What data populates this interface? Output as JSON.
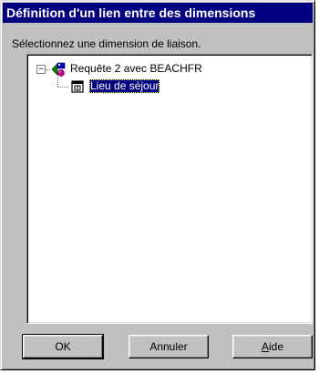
{
  "window": {
    "title": "Définition d'un lien entre des dimensions"
  },
  "prompt": "Sélectionnez une dimension de liaison.",
  "tree": {
    "root": {
      "label": "Requête 2 avec BEACHFR",
      "expander": "−",
      "icon": "query-icon",
      "expanded": true
    },
    "children": [
      {
        "label": "Lieu de séjour",
        "icon": "dimension-icon",
        "selected": true
      }
    ]
  },
  "buttons": {
    "ok": "OK",
    "cancel": "Annuler",
    "help_prefix": "",
    "help_accel": "A",
    "help_rest": "ide"
  },
  "colors": {
    "titlebar": "#000080",
    "selection": "#000080",
    "dialog_bg": "#c0c0c0"
  }
}
